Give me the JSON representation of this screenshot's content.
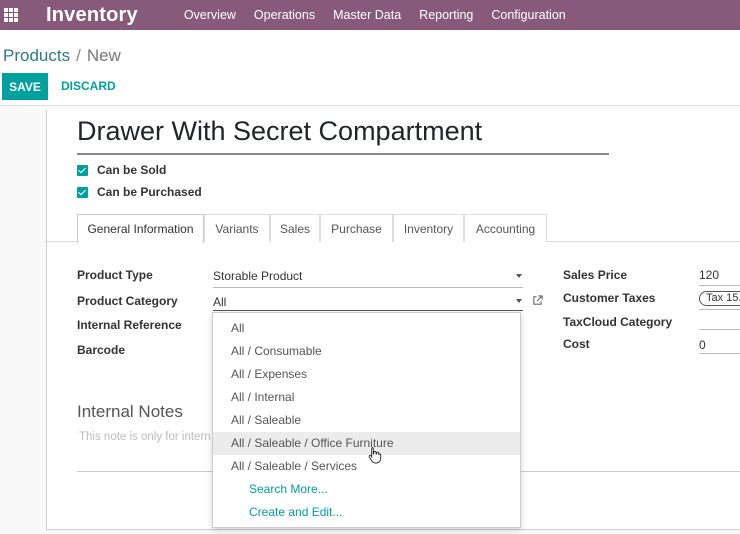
{
  "navbar": {
    "app_title": "Inventory",
    "menu": [
      "Overview",
      "Operations",
      "Master Data",
      "Reporting",
      "Configuration"
    ]
  },
  "breadcrumb": {
    "parent": "Products",
    "separator": "/",
    "current": "New"
  },
  "buttons": {
    "save": "SAVE",
    "discard": "DISCARD"
  },
  "product": {
    "name": "Drawer With Secret Compartment",
    "can_be_sold": {
      "label": "Can be Sold",
      "checked": true
    },
    "can_be_purchased": {
      "label": "Can be Purchased",
      "checked": true
    }
  },
  "tabs": [
    "General Information",
    "Variants",
    "Sales",
    "Purchase",
    "Inventory",
    "Accounting"
  ],
  "active_tab": "General Information",
  "fields": {
    "product_type": {
      "label": "Product Type",
      "value": "Storable Product"
    },
    "product_category": {
      "label": "Product Category",
      "value": "All"
    },
    "internal_reference": {
      "label": "Internal Reference"
    },
    "barcode": {
      "label": "Barcode"
    },
    "sales_price": {
      "label": "Sales Price",
      "value": "120"
    },
    "customer_taxes": {
      "label": "Customer Taxes",
      "value": "Tax 15."
    },
    "taxcloud_category": {
      "label": "TaxCloud Category"
    },
    "cost": {
      "label": "Cost",
      "value": "0"
    }
  },
  "notes": {
    "title": "Internal Notes",
    "placeholder": "This note is only for intern"
  },
  "dropdown": {
    "options": [
      "All",
      "All / Consumable",
      "All / Expenses",
      "All / Internal",
      "All / Saleable",
      "All / Saleable / Office Furniture",
      "All / Saleable / Services"
    ],
    "hovered": "All / Saleable / Office Furniture",
    "actions": [
      "Search More...",
      "Create and Edit..."
    ]
  },
  "colors": {
    "navbar": "#875a7b",
    "accent": "#00a09d",
    "link": "#2c7a8c"
  },
  "icons": [
    "apps-grid-icon",
    "checkbox-checked-icon",
    "dropdown-caret-icon",
    "external-link-icon",
    "pointer-cursor-icon"
  ]
}
